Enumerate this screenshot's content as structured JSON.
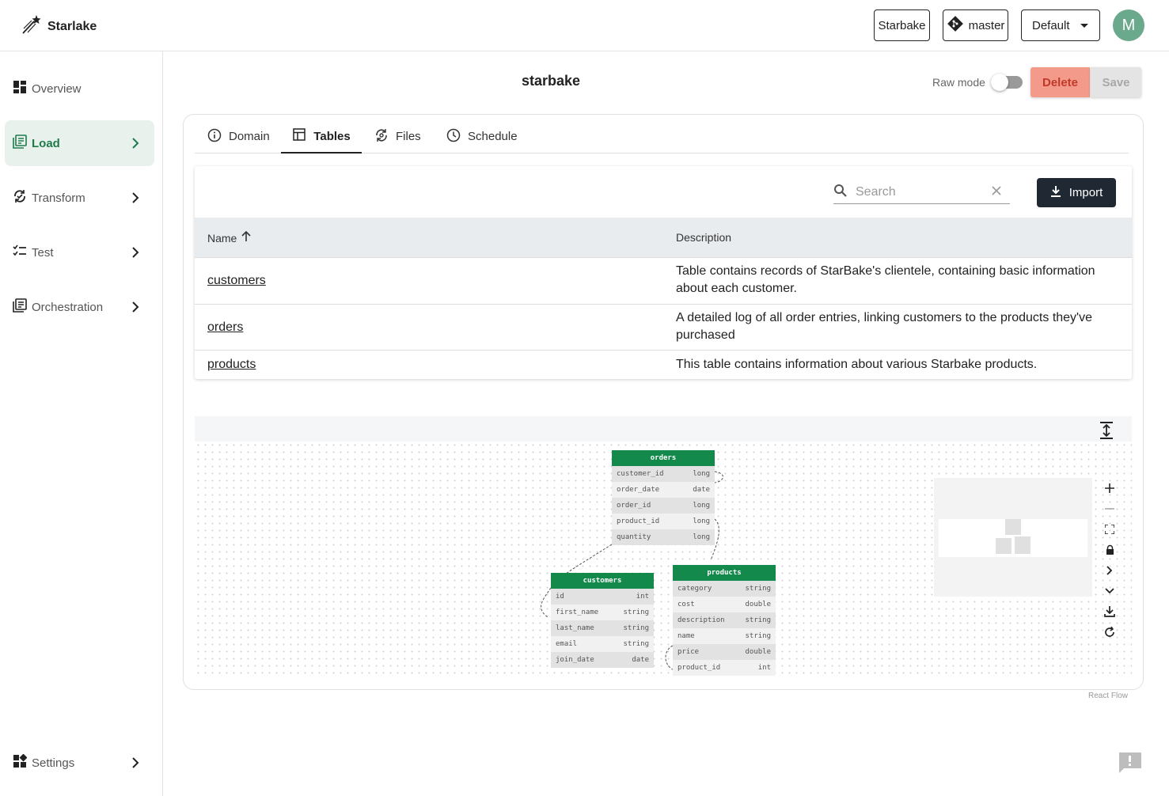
{
  "app": {
    "name": "Starlake"
  },
  "header": {
    "project_button": "Starbake",
    "branch_button": "master",
    "env_select": "Default",
    "avatar_initial": "M"
  },
  "sidebar": {
    "items": [
      {
        "label": "Overview",
        "icon": "dashboard-icon",
        "active": false
      },
      {
        "label": "Load",
        "icon": "load-icon",
        "active": true
      },
      {
        "label": "Transform",
        "icon": "transform-icon",
        "active": false
      },
      {
        "label": "Test",
        "icon": "checklist-icon",
        "active": false
      },
      {
        "label": "Orchestration",
        "icon": "orchestration-icon",
        "active": false
      }
    ],
    "settings_label": "Settings"
  },
  "page": {
    "title": "starbake",
    "raw_mode_label": "Raw mode",
    "raw_mode_on": false,
    "delete_label": "Delete",
    "save_label": "Save"
  },
  "tabs": [
    {
      "label": "Domain",
      "icon": "info-icon"
    },
    {
      "label": "Tables",
      "icon": "table-icon",
      "active": true
    },
    {
      "label": "Files",
      "icon": "files-icon"
    },
    {
      "label": "Schedule",
      "icon": "clock-icon"
    }
  ],
  "table": {
    "search_placeholder": "Search",
    "import_label": "Import",
    "headers": {
      "name": "Name",
      "description": "Description"
    },
    "rows": [
      {
        "name": "customers",
        "description": "Table contains records of StarBake's clientele, containing basic information about each customer."
      },
      {
        "name": "orders",
        "description": "A detailed log of all order entries, linking customers to the products they've purchased"
      },
      {
        "name": "products",
        "description": "This table contains information about various Starbake products."
      }
    ]
  },
  "diagram": {
    "entities": [
      {
        "name": "orders",
        "columns": [
          {
            "name": "customer_id",
            "type": "long"
          },
          {
            "name": "order_date",
            "type": "date"
          },
          {
            "name": "order_id",
            "type": "long"
          },
          {
            "name": "product_id",
            "type": "long"
          },
          {
            "name": "quantity",
            "type": "long"
          }
        ]
      },
      {
        "name": "customers",
        "columns": [
          {
            "name": "id",
            "type": "int"
          },
          {
            "name": "first_name",
            "type": "string"
          },
          {
            "name": "last_name",
            "type": "string"
          },
          {
            "name": "email",
            "type": "string"
          },
          {
            "name": "join_date",
            "type": "date"
          }
        ]
      },
      {
        "name": "products",
        "columns": [
          {
            "name": "category",
            "type": "string"
          },
          {
            "name": "cost",
            "type": "double"
          },
          {
            "name": "description",
            "type": "string"
          },
          {
            "name": "name",
            "type": "string"
          },
          {
            "name": "price",
            "type": "double"
          },
          {
            "name": "product_id",
            "type": "int"
          }
        ]
      }
    ],
    "attribution": "React Flow"
  },
  "colors": {
    "accent_green": "#138a4c",
    "sidebar_active_bg": "#e8f1ec",
    "delete_bg": "#f39a8a",
    "import_bg": "#1f2833"
  }
}
